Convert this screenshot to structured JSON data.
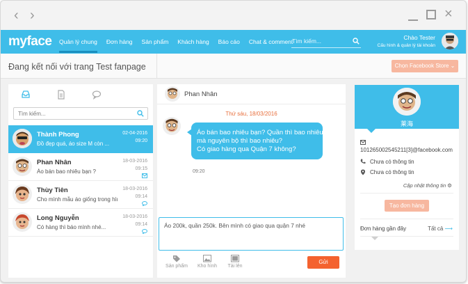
{
  "window": {
    "controls": {
      "back": "‹",
      "forward": "›",
      "close": "×"
    }
  },
  "topbar": {
    "logo": "myface",
    "menu": [
      {
        "label": "Quản lý chung",
        "active": true
      },
      {
        "label": "Đơn hàng"
      },
      {
        "label": "Sản phẩm"
      },
      {
        "label": "Khách hàng"
      },
      {
        "label": "Báo cáo"
      },
      {
        "label": "Chat & comment"
      }
    ],
    "search_placeholder": "Tìm kiếm...",
    "user_name": "Chào Tester",
    "user_sub": "Cấu hình & quản lý tài khoản"
  },
  "page": {
    "title": "Đang kết nối với trang Test fanpage",
    "store_button": "Chọn Facebook Store",
    "store_caret": "⌄"
  },
  "left": {
    "search_placeholder": "Tìm kiếm...",
    "conversations": [
      {
        "name": "Thành Phong",
        "preview": "Đồ đẹp quá, áo size M còn ...",
        "date": "02-04-2016",
        "time": "09:20",
        "selected": true
      },
      {
        "name": "Phan Nhân",
        "preview": "Áo bán bao nhiêu bạn ?",
        "date": "18-03-2016",
        "time": "09:15",
        "icon": "mail-icon"
      },
      {
        "name": "Thùy Tiên",
        "preview": "Cho mình mẫu áo giống trong hình...",
        "date": "18-03-2016",
        "time": "09:14",
        "icon": "chat-icon"
      },
      {
        "name": "Long Nguyễn",
        "preview": "Có hàng thì báo mình nhé...",
        "date": "18-03-2016",
        "time": "09:14",
        "icon": "chat-icon"
      }
    ]
  },
  "chat": {
    "contact_name": "Phan Nhân",
    "day_label": "Thứ sáu, 18/03/2016",
    "message_lines": [
      "Áo bán bao nhiêu bạn? Quần thì bao nhiêu?",
      "mà nguyên bộ thì bao nhiêu?",
      "Có giao hàng qua Quận 7 không?"
    ],
    "message_time": "09:20",
    "compose_text": "Áo 200k, quần 250k. Bên mình có giao qua quận 7 nhé",
    "tools": {
      "products": "Sản phẩm",
      "gallery": "Kho hình",
      "upload": "Tải lên"
    },
    "send_label": "Gửi"
  },
  "profile": {
    "name": "莱海",
    "email": "101265002545211[3]@facebook.com",
    "phone": "Chưa có thông tin",
    "address": "Chưa có thông tin",
    "update_label": "Cập nhật thông tin",
    "create_order": "Tạo đơn hàng",
    "recent_orders": "Đơn hàng gần đây",
    "all_label": "Tất cả",
    "all_arrow": "⟶"
  },
  "colors": {
    "accent": "#3fbde9",
    "orange": "#f4622f",
    "peach": "#f7b79f",
    "date_red": "#e8703e"
  }
}
